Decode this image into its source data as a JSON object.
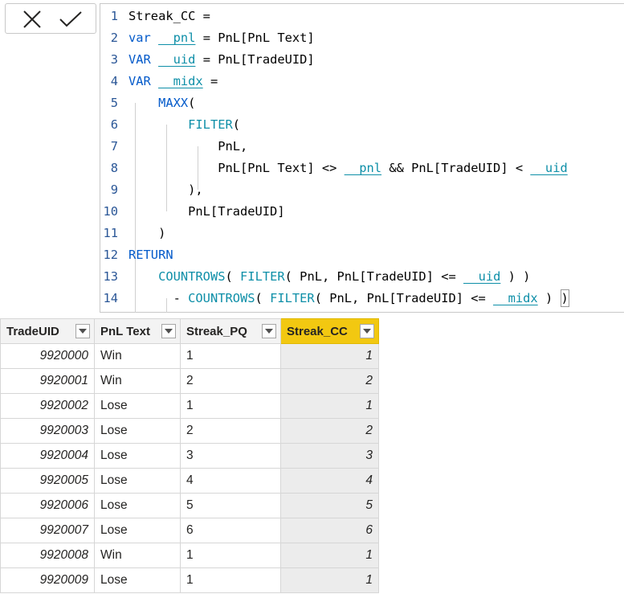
{
  "toolbar": {
    "cancel_icon": "close-icon",
    "commit_icon": "check-icon"
  },
  "editor": {
    "lines": [
      {
        "num": "1",
        "segments": [
          {
            "t": "Streak_CC =",
            "c": "plain"
          }
        ]
      },
      {
        "num": "2",
        "segments": [
          {
            "t": "var ",
            "c": "kw"
          },
          {
            "t": "__pnl",
            "c": "vr"
          },
          {
            "t": " = PnL[PnL Text]",
            "c": "plain"
          }
        ]
      },
      {
        "num": "3",
        "segments": [
          {
            "t": "VAR ",
            "c": "kw"
          },
          {
            "t": "__uid",
            "c": "vr"
          },
          {
            "t": " = PnL[TradeUID]",
            "c": "plain"
          }
        ]
      },
      {
        "num": "4",
        "segments": [
          {
            "t": "VAR ",
            "c": "kw"
          },
          {
            "t": "__midx",
            "c": "vr"
          },
          {
            "t": " =",
            "c": "plain"
          }
        ]
      },
      {
        "num": "5",
        "segments": [
          {
            "t": "    ",
            "c": "plain"
          },
          {
            "t": "MAXX",
            "c": "kw"
          },
          {
            "t": "(",
            "c": "plain"
          }
        ]
      },
      {
        "num": "6",
        "segments": [
          {
            "t": "        ",
            "c": "plain"
          },
          {
            "t": "FILTER",
            "c": "fn"
          },
          {
            "t": "(",
            "c": "plain"
          }
        ]
      },
      {
        "num": "7",
        "segments": [
          {
            "t": "            PnL,",
            "c": "plain"
          }
        ]
      },
      {
        "num": "8",
        "segments": [
          {
            "t": "            PnL[PnL Text] <> ",
            "c": "plain"
          },
          {
            "t": "__pnl",
            "c": "vr"
          },
          {
            "t": " && PnL[TradeUID] < ",
            "c": "plain"
          },
          {
            "t": "__uid",
            "c": "vr"
          }
        ]
      },
      {
        "num": "9",
        "segments": [
          {
            "t": "        ),",
            "c": "plain"
          }
        ]
      },
      {
        "num": "10",
        "segments": [
          {
            "t": "        PnL[TradeUID]",
            "c": "plain"
          }
        ]
      },
      {
        "num": "11",
        "segments": [
          {
            "t": "    )",
            "c": "plain"
          }
        ]
      },
      {
        "num": "12",
        "segments": [
          {
            "t": "RETURN",
            "c": "kw"
          }
        ]
      },
      {
        "num": "13",
        "segments": [
          {
            "t": "    ",
            "c": "plain"
          },
          {
            "t": "COUNTROWS",
            "c": "fn"
          },
          {
            "t": "( ",
            "c": "plain"
          },
          {
            "t": "FILTER",
            "c": "fn"
          },
          {
            "t": "( PnL, PnL[TradeUID] <= ",
            "c": "plain"
          },
          {
            "t": "__uid",
            "c": "vr"
          },
          {
            "t": " ) )",
            "c": "plain"
          }
        ]
      },
      {
        "num": "14",
        "segments": [
          {
            "t": "      - ",
            "c": "plain"
          },
          {
            "t": "COUNTROWS",
            "c": "fn"
          },
          {
            "t": "( ",
            "c": "plain"
          },
          {
            "t": "FILTER",
            "c": "fn"
          },
          {
            "t": "( PnL, PnL[TradeUID] <= ",
            "c": "plain"
          },
          {
            "t": "__midx",
            "c": "vr"
          },
          {
            "t": " ) ",
            "c": "plain"
          },
          {
            "t": ")",
            "c": "box"
          }
        ]
      }
    ]
  },
  "table": {
    "columns": [
      "TradeUID",
      "PnL Text",
      "Streak_PQ",
      "Streak_CC"
    ],
    "active_column": "Streak_CC",
    "rows": [
      [
        "9920000",
        "Win",
        "1",
        "1"
      ],
      [
        "9920001",
        "Win",
        "2",
        "2"
      ],
      [
        "9920002",
        "Lose",
        "1",
        "1"
      ],
      [
        "9920003",
        "Lose",
        "2",
        "2"
      ],
      [
        "9920004",
        "Lose",
        "3",
        "3"
      ],
      [
        "9920005",
        "Lose",
        "4",
        "4"
      ],
      [
        "9920006",
        "Lose",
        "5",
        "5"
      ],
      [
        "9920007",
        "Lose",
        "6",
        "6"
      ],
      [
        "9920008",
        "Win",
        "1",
        "1"
      ],
      [
        "9920009",
        "Lose",
        "1",
        "1"
      ]
    ]
  },
  "colors": {
    "keyword": "#035aca",
    "function": "#0e8fa8",
    "active_header": "#f2c811",
    "computed_column_bg": "#ececec"
  }
}
